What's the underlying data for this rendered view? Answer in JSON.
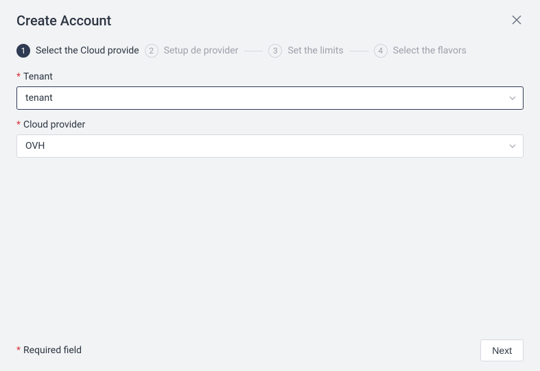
{
  "header": {
    "title": "Create Account"
  },
  "steps": [
    {
      "num": "1",
      "label": "Select the Cloud provide",
      "active": true
    },
    {
      "num": "2",
      "label": "Setup de provider",
      "active": false
    },
    {
      "num": "3",
      "label": "Set the limits",
      "active": false
    },
    {
      "num": "4",
      "label": "Select the flavors",
      "active": false
    }
  ],
  "form": {
    "tenant": {
      "label": "Tenant",
      "value": "tenant",
      "required": true
    },
    "provider": {
      "label": "Cloud provider",
      "value": "OVH",
      "required": true
    }
  },
  "footer": {
    "required_note": "Required field",
    "next_label": "Next"
  },
  "symbols": {
    "asterisk": "*"
  }
}
